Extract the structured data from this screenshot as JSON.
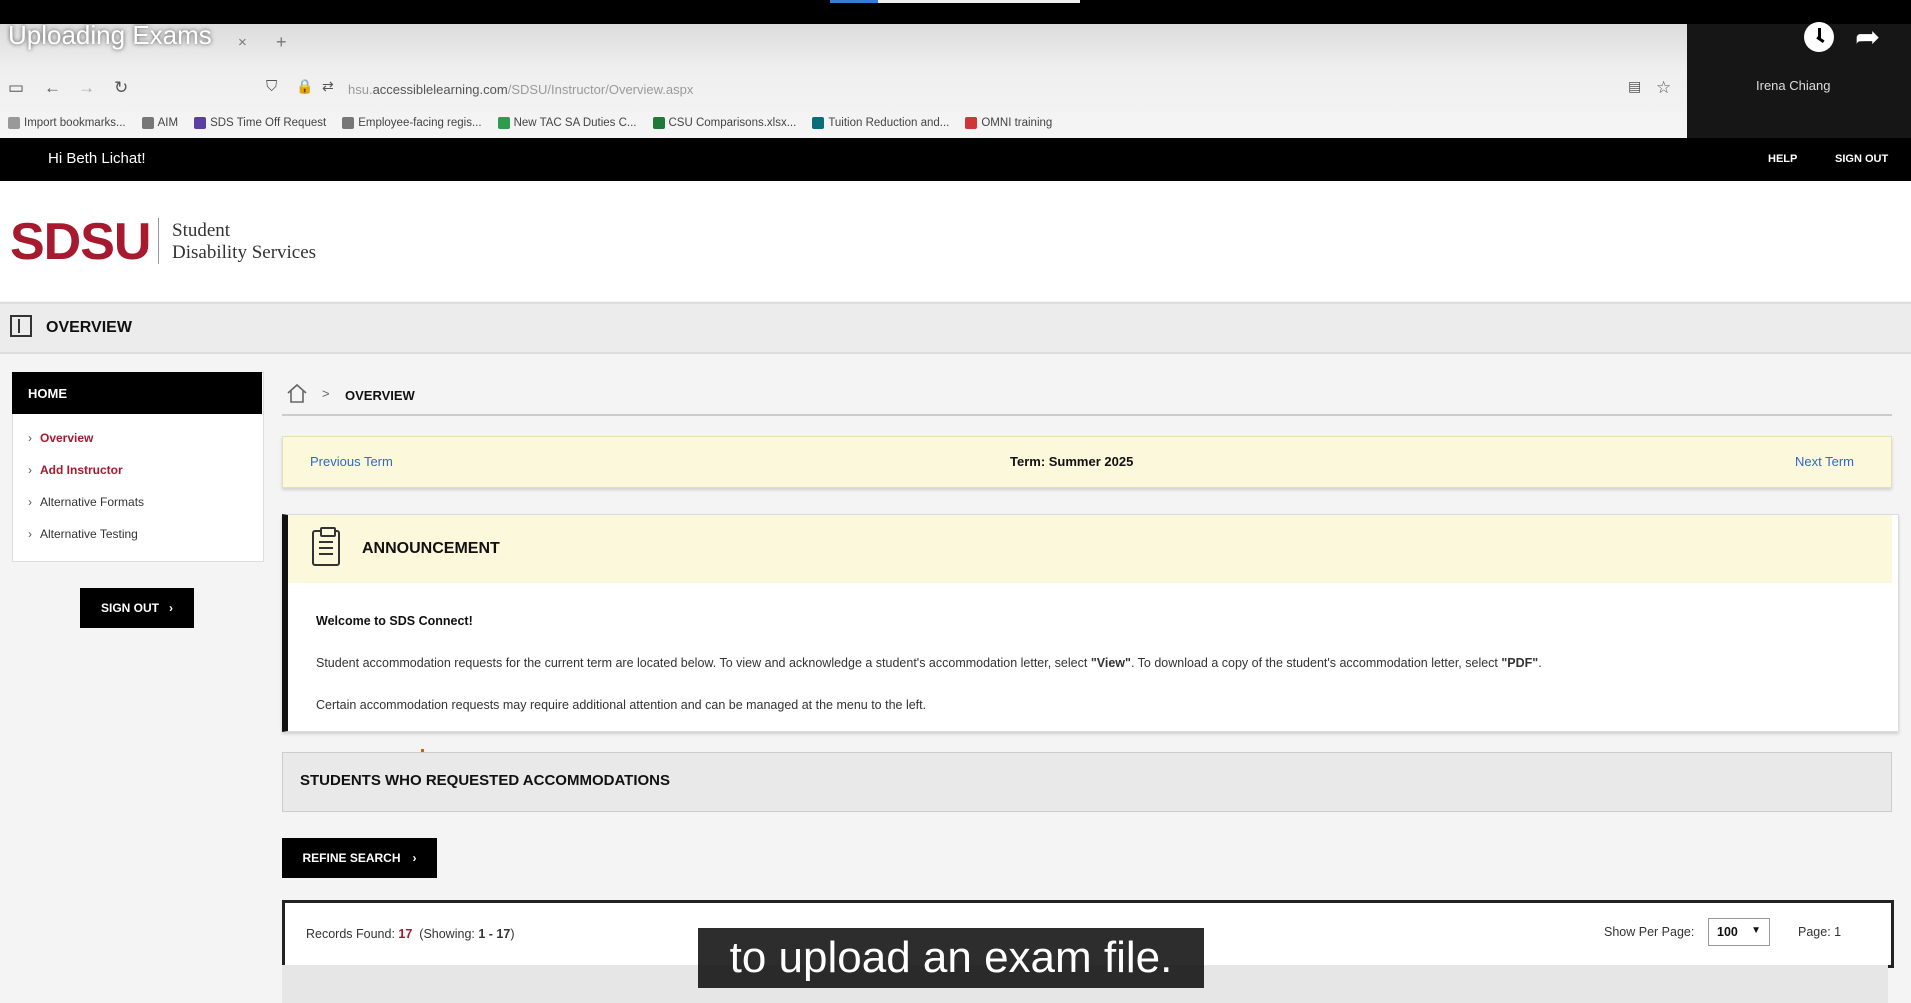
{
  "video": {
    "title": "Uploading Exams",
    "caption": "to upload an exam file."
  },
  "participant": {
    "name": "Irena Chiang"
  },
  "browser": {
    "url_host": "accessiblelearning.com",
    "url_prefix": "hsu.",
    "url_path": "/SDSU/Instructor/Overview.aspx",
    "bookmarks": [
      {
        "label": "Import bookmarks...",
        "color": "#999999"
      },
      {
        "label": "AIM",
        "color": "#777777"
      },
      {
        "label": "SDS Time Off Request",
        "color": "#5b3fa0"
      },
      {
        "label": "Employee-facing regis...",
        "color": "#777777"
      },
      {
        "label": "New TAC SA Duties C...",
        "color": "#2e9b4e"
      },
      {
        "label": "CSU Comparisons.xlsx...",
        "color": "#1f7a3a"
      },
      {
        "label": "Tuition Reduction and...",
        "color": "#0a6e7a"
      },
      {
        "label": "OMNI training",
        "color": "#d13438"
      }
    ]
  },
  "header": {
    "greeting": "Hi Beth Lichat!",
    "help": "HELP",
    "sign_out": "SIGN OUT"
  },
  "logo": {
    "mark": "SDSU",
    "line1": "Student",
    "line2": "Disability Services",
    "color": "#a6192e"
  },
  "overview_bar": {
    "title": "OVERVIEW"
  },
  "sidebar": {
    "heading": "HOME",
    "items": [
      {
        "label": "Overview"
      },
      {
        "label": "Add Instructor"
      },
      {
        "label": "Alternative Formats"
      },
      {
        "label": "Alternative Testing"
      }
    ],
    "sign_out": "SIGN OUT"
  },
  "breadcrumb": {
    "current": "OVERVIEW"
  },
  "term": {
    "previous": "Previous Term",
    "label": "Term: Summer 2025",
    "next": "Next Term"
  },
  "announcement": {
    "title": "ANNOUNCEMENT",
    "welcome": "Welcome to SDS Connect!",
    "p1_a": "Student accommodation requests for the current term are located below. To view and acknowledge a student's accommodation letter, select ",
    "p1_view": "\"View\"",
    "p1_b": ". To download a copy of the student's accommodation letter, select ",
    "p1_pdf": "\"PDF\"",
    "p1_c": ".",
    "p2": "Certain accommodation requests may require additional attention and can be managed at the menu to the left."
  },
  "students": {
    "title": "STUDENTS WHO REQUESTED ACCOMMODATIONS",
    "refine": "REFINE SEARCH"
  },
  "records": {
    "found_label": "Records Found:",
    "found_count": "17",
    "showing_label": "(Showing:",
    "showing_range": "1 - 17",
    "showing_end": ")",
    "show_per_page": "Show Per Page:",
    "per_page_value": "100",
    "page_label": "Page: 1"
  }
}
